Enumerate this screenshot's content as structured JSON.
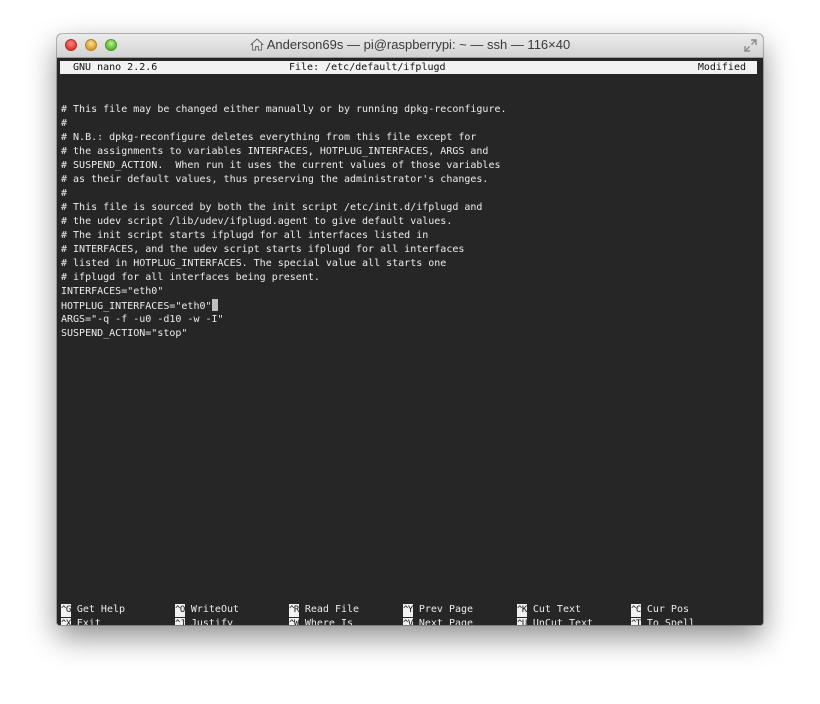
{
  "window": {
    "title": "Anderson69s — pi@raspberrypi: ~ — ssh — 116×40"
  },
  "nano": {
    "version": "GNU nano 2.2.6",
    "file": "File: /etc/default/ifplugd",
    "status": "Modified"
  },
  "file_lines": [
    "",
    "# This file may be changed either manually or by running dpkg-reconfigure.",
    "#",
    "# N.B.: dpkg-reconfigure deletes everything from this file except for",
    "# the assignments to variables INTERFACES, HOTPLUG_INTERFACES, ARGS and",
    "# SUSPEND_ACTION.  When run it uses the current values of those variables",
    "# as their default values, thus preserving the administrator's changes.",
    "#",
    "# This file is sourced by both the init script /etc/init.d/ifplugd and",
    "# the udev script /lib/udev/ifplugd.agent to give default values.",
    "# The init script starts ifplugd for all interfaces listed in",
    "# INTERFACES, and the udev script starts ifplugd for all interfaces",
    "# listed in HOTPLUG_INTERFACES. The special value all starts one",
    "# ifplugd for all interfaces being present.",
    "INTERFACES=\"eth0\"",
    "HOTPLUG_INTERFACES=\"eth0\"",
    "ARGS=\"-q -f -u0 -d10 -w -I\"",
    "SUSPEND_ACTION=\"stop\""
  ],
  "cursor_line_index": 15,
  "shortcuts": [
    {
      "key": "^G",
      "label": "Get Help"
    },
    {
      "key": "^O",
      "label": "WriteOut"
    },
    {
      "key": "^R",
      "label": "Read File"
    },
    {
      "key": "^Y",
      "label": "Prev Page"
    },
    {
      "key": "^K",
      "label": "Cut Text"
    },
    {
      "key": "^C",
      "label": "Cur Pos"
    },
    {
      "key": "^X",
      "label": "Exit"
    },
    {
      "key": "^J",
      "label": "Justify"
    },
    {
      "key": "^W",
      "label": "Where Is"
    },
    {
      "key": "^V",
      "label": "Next Page"
    },
    {
      "key": "^U",
      "label": "UnCut Text"
    },
    {
      "key": "^T",
      "label": "To Spell"
    }
  ],
  "icons": {
    "title": "home-icon",
    "resize": "fullscreen-icon"
  }
}
